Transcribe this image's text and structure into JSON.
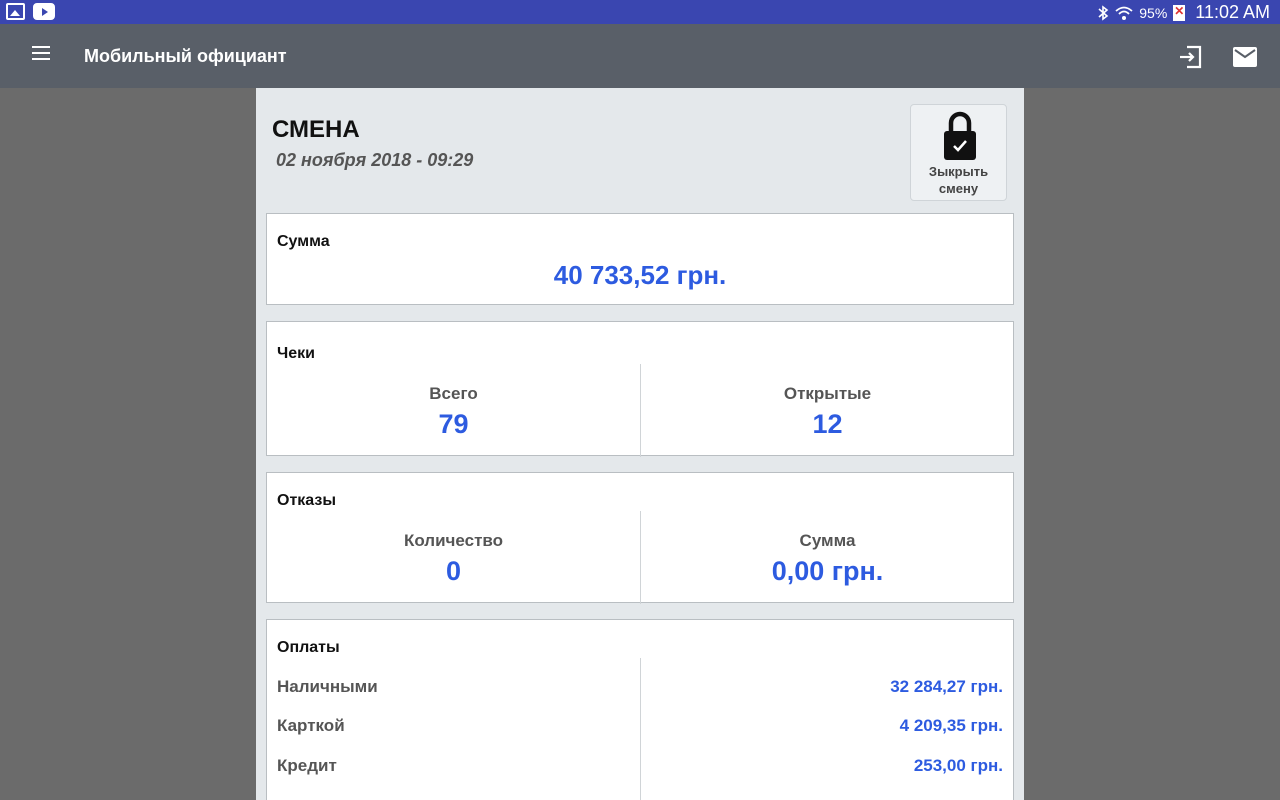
{
  "status_bar": {
    "left_icons": [
      "gallery-icon",
      "youtube-icon"
    ],
    "right_icons": [
      "bluetooth-icon",
      "wifi-icon",
      "battery-icon"
    ],
    "battery": "95%",
    "time": "11:02 AM"
  },
  "app_bar": {
    "title": "Мобильный официант",
    "icons": [
      "menu-icon",
      "exit-icon",
      "mail-icon"
    ]
  },
  "shift": {
    "title": "СМЕНА",
    "date": "02 ноября 2018 - 09:29",
    "close_button_label": "Зыкрыть\nсмену"
  },
  "sum_card": {
    "title": "Сумма",
    "value": "40 733,52 грн."
  },
  "checks_card": {
    "title": "Чеки",
    "total_label": "Всего",
    "total_value": "79",
    "open_label": "Открытые",
    "open_value": "12"
  },
  "refusals_card": {
    "title": "Отказы",
    "count_label": "Количество",
    "count_value": "0",
    "sum_label": "Сумма",
    "sum_value": "0,00 грн."
  },
  "payments_card": {
    "title": "Оплаты",
    "rows": [
      {
        "name": "Наличными",
        "value": "32 284,27 грн."
      },
      {
        "name": "Карткой",
        "value": "4 209,35 грн."
      },
      {
        "name": "Кредит",
        "value": "253,00 грн."
      }
    ]
  },
  "colors": {
    "status_bar": "#3a46b0",
    "app_bar": "#595f68",
    "accent_value": "#2d5be0",
    "panel": "#e4e8eb",
    "backdrop": "#6b6b6b"
  }
}
